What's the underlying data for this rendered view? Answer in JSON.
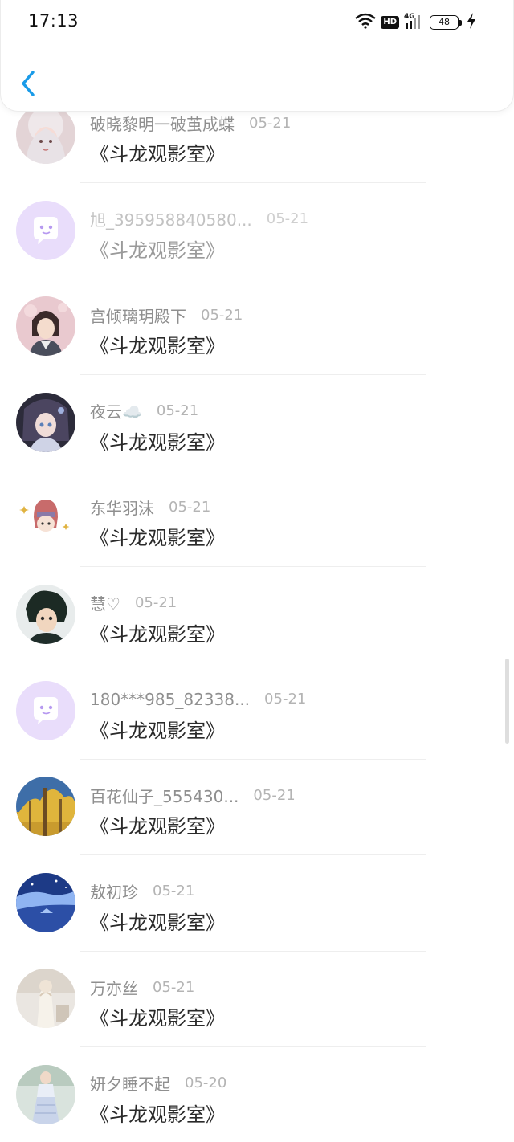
{
  "status_bar": {
    "time": "17:13",
    "network": "4G",
    "hd": "HD",
    "battery": "48"
  },
  "header": {
    "back_icon": "chevron-left-icon"
  },
  "items": [
    {
      "name": "破晓黎明一破茧成蝶",
      "date": "05-21",
      "message": "《斗龙观影室》"
    },
    {
      "name": "旭_395958840580...",
      "date": "05-21",
      "message": "《斗龙观影室》"
    },
    {
      "name": "宫倾璃玥殿下",
      "date": "05-21",
      "message": "《斗龙观影室》"
    },
    {
      "name": "夜云☁️",
      "date": "05-21",
      "message": "《斗龙观影室》"
    },
    {
      "name": "东华羽沫",
      "date": "05-21",
      "message": "《斗龙观影室》"
    },
    {
      "name": "慧♡",
      "date": "05-21",
      "message": "《斗龙观影室》"
    },
    {
      "name": "180***985_82338...",
      "date": "05-21",
      "message": "《斗龙观影室》"
    },
    {
      "name": "百花仙子_555430...",
      "date": "05-21",
      "message": "《斗龙观影室》"
    },
    {
      "name": "敖初珍",
      "date": "05-21",
      "message": "《斗龙观影室》"
    },
    {
      "name": "万亦丝",
      "date": "05-21",
      "message": "《斗龙观影室》"
    },
    {
      "name": "妍夕睡不起",
      "date": "05-20",
      "message": "《斗龙观影室》"
    }
  ],
  "colors": {
    "accent": "#1a9be8",
    "default_avatar_bg": "#e9ddfb",
    "default_avatar_icon": "#b79af0"
  }
}
